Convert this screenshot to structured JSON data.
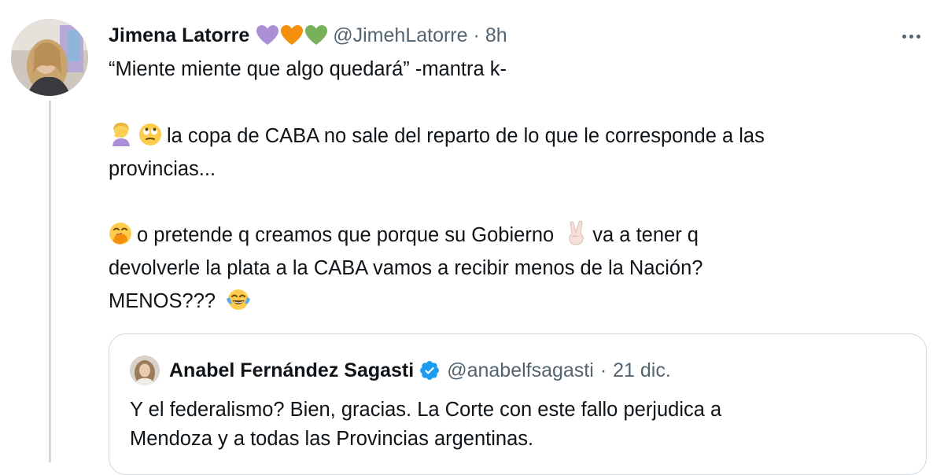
{
  "tweet": {
    "author": {
      "display_name": "Jimena Latorre",
      "emoji_hearts": [
        "purple-heart",
        "orange-heart",
        "green-heart"
      ],
      "handle": "@JimehLatorre",
      "time": "8h"
    },
    "lines": [
      "“Miente miente que algo quedará” -mantra k-",
      "la copa de CABA no sale del reparto de lo que le corresponde a las",
      "provincias...",
      "o pretende q creamos que porque su Gobierno",
      "va a tener q",
      "devolverle la plata a la CABA vamos a recibir menos de la Nación?",
      "MENOS???"
    ],
    "emoji": {
      "facepalm": "woman-facepalming",
      "eye_roll": "face-with-rolling-eyes",
      "hand_over_mouth": "face-with-hand-over-mouth",
      "victory": "victory-hand",
      "laughing": "face-with-tears-of-joy"
    }
  },
  "quote": {
    "display_name": "Anabel Fernández Sagasti",
    "handle": "@anabelfsagasti",
    "time": "21 dic.",
    "lines": [
      "Y el federalismo? Bien, gracias. La Corte con este fallo perjudica a",
      "Mendoza y a todas las Provincias argentinas."
    ]
  },
  "colors": {
    "text": "#0f1419",
    "secondary": "#536471",
    "border": "#cfd9de",
    "verified": "#1d9bf0",
    "purple_heart": "#aa8ed6",
    "orange_heart": "#f4900c",
    "green_heart": "#78b159"
  }
}
